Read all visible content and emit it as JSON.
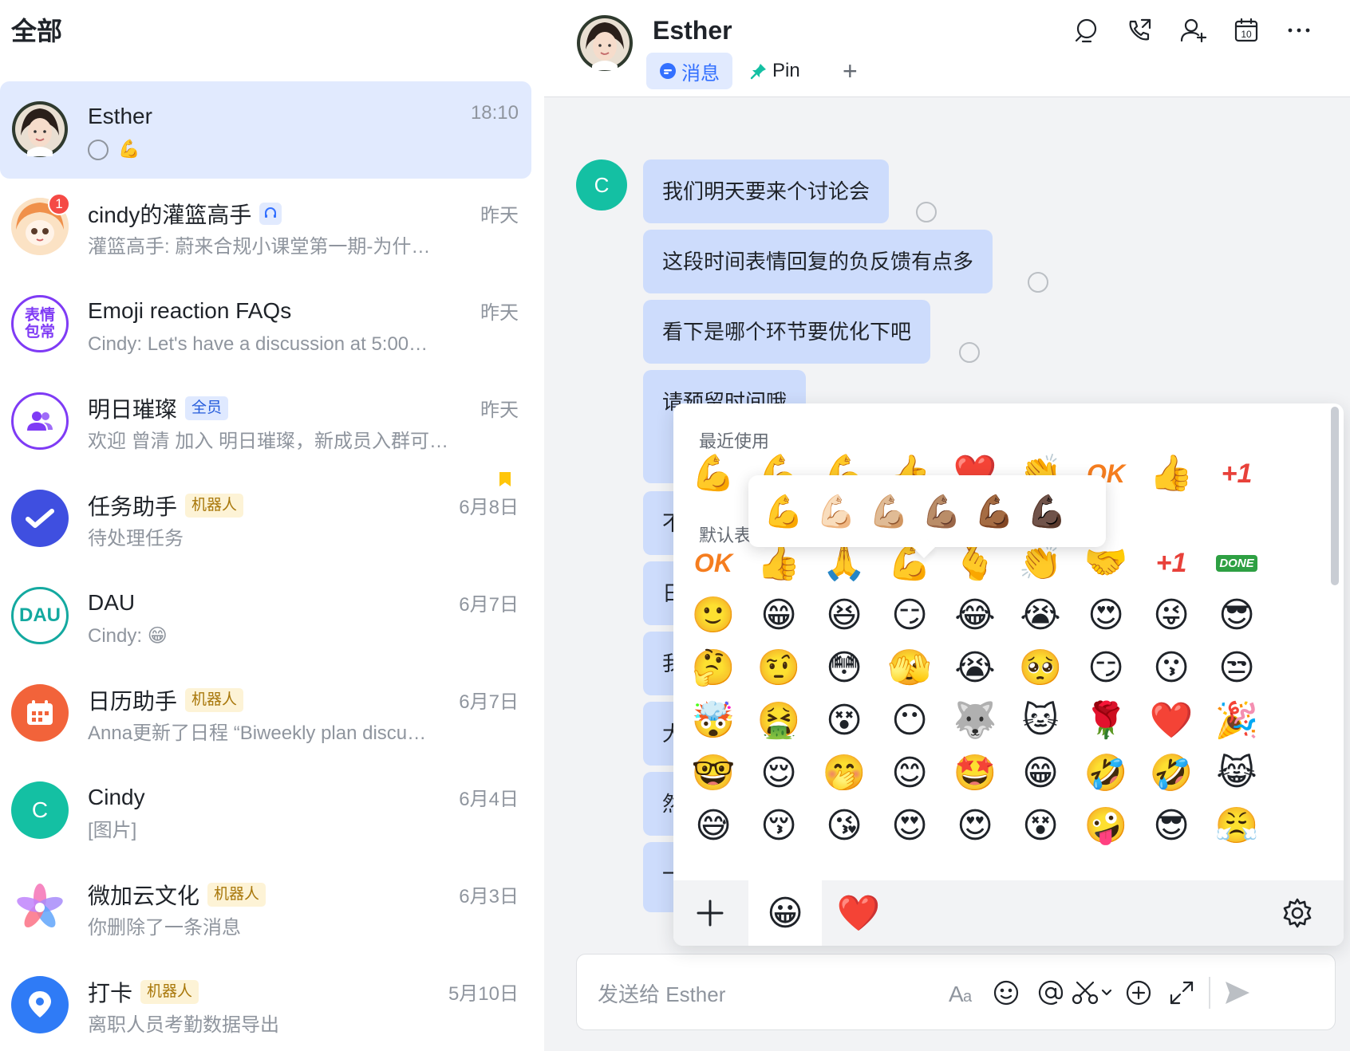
{
  "left": {
    "title": "全部",
    "chats": [
      {
        "name": "Esther",
        "time": "18:10",
        "preview": "💪",
        "active": true
      },
      {
        "name": "cindy的灌篮高手",
        "time": "昨天",
        "preview": "灌篮高手: 蔚来合规小课堂第一期-为什…",
        "badge": "1"
      },
      {
        "name": "Emoji reaction FAQs",
        "time": "昨天",
        "preview": "Cindy: Let's have a discussion at 5:00…",
        "avatar_text": "表情\n包常"
      },
      {
        "name": "明日璀璨",
        "time": "昨天",
        "preview": "欢迎 曾清 加入 明日璀璨，新成员入群可…",
        "tag": "全员"
      },
      {
        "name": "任务助手",
        "time": "6月8日",
        "preview": "待处理任务",
        "tag": "机器人"
      },
      {
        "name": "DAU",
        "time": "6月7日",
        "preview": "Cindy: 😁",
        "avatar_text": "DAU"
      },
      {
        "name": "日历助手",
        "time": "6月7日",
        "preview": "Anna更新了日程 “Biweekly plan discu…",
        "tag": "机器人"
      },
      {
        "name": "Cindy",
        "time": "6月4日",
        "preview": "[图片]",
        "avatar_text": "C"
      },
      {
        "name": "微加云文化",
        "time": "6月3日",
        "preview": "你删除了一条消息",
        "tag": "机器人"
      },
      {
        "name": "打卡",
        "time": "5月10日",
        "preview": "离职人员考勤数据导出",
        "tag": "机器人"
      }
    ]
  },
  "header": {
    "name": "Esther",
    "tabs": {
      "messages": "消息",
      "pin": "Pin",
      "add": "+"
    }
  },
  "conversation": {
    "sender_avatar": "C",
    "messages": [
      "我们明天要来个讨论会",
      "这段时间表情回复的负反馈有点多",
      "看下是哪个环节要优化下吧",
      "请预留时间哦"
    ],
    "partial_bubbles": [
      "不",
      "日",
      "我",
      "大",
      "然",
      "一"
    ]
  },
  "emoji_panel": {
    "recent_title": "最近使用",
    "default_title": "默认表情",
    "recent": [
      "💪",
      "💪",
      "💪",
      "👍",
      "❤️",
      "👏",
      "OK",
      "👍",
      "+1"
    ],
    "skin_tones": [
      "💪",
      "💪🏻",
      "💪🏼",
      "💪🏽",
      "💪🏾",
      "💪🏿"
    ],
    "default_rows": [
      [
        "OK",
        "👍",
        "🙏",
        "💪",
        "🫰",
        "👏",
        "🤝",
        "+1",
        "DONE"
      ],
      [
        "🙂",
        "😁",
        "😆",
        "😏",
        "😂",
        "😭",
        "😍",
        "😜",
        "😎"
      ],
      [
        "🤔",
        "🤨",
        "😳",
        "🫣",
        "😭",
        "🥺",
        "😏",
        "😗",
        "😒"
      ],
      [
        "🤯",
        "🤮",
        "😵",
        "😶",
        "🐺",
        "🐱",
        "🌹",
        "❤️",
        "🎉"
      ],
      [
        "🤓",
        "😌",
        "🤭",
        "😊",
        "🤩",
        "😁",
        "🤣",
        "🤣",
        "😹"
      ],
      [
        "😅",
        "😚",
        "😘",
        "😍",
        "😍",
        "😵",
        "🤪",
        "😎",
        "😤"
      ]
    ],
    "footer": {
      "add": "+",
      "face": "😀",
      "heart": "❤️"
    }
  },
  "composer": {
    "placeholder": "发送给 Esther"
  },
  "colors": {
    "accent": "#3370ff",
    "active_chat_bg": "#e1eafe",
    "bubble_bg": "#cddcfc",
    "badge_red": "#f54a45",
    "bot_tag_bg": "#fdf3d6",
    "teal_avatar": "#14c0a3"
  }
}
